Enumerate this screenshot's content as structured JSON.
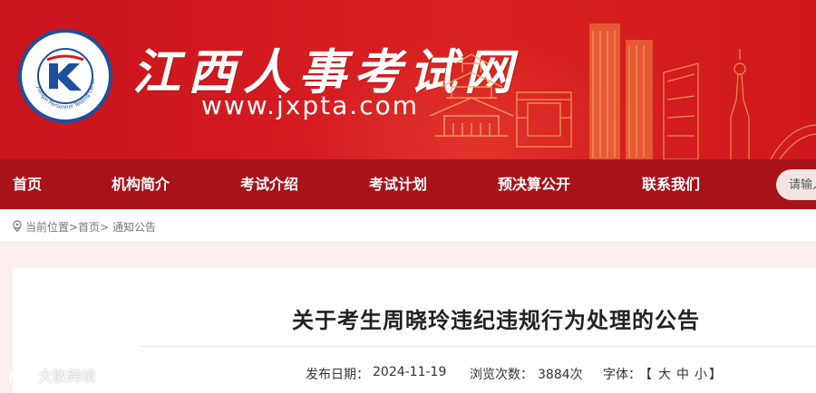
{
  "header": {
    "site_title": "江西人事考试网",
    "site_url": "www.jxpta.com",
    "logo_text": "Jiangxi Personnel Testing Center"
  },
  "nav": {
    "items": [
      {
        "label": "首页"
      },
      {
        "label": "机构简介"
      },
      {
        "label": "考试介绍"
      },
      {
        "label": "考试计划"
      },
      {
        "label": "预决算公开"
      },
      {
        "label": "联系我们"
      }
    ],
    "search_placeholder": "请输入"
  },
  "breadcrumb": {
    "prefix": "当前位置>",
    "home": "首页",
    "sep": ">",
    "current": "通知公告"
  },
  "article": {
    "title": "关于考生周晓玲违纪违规行为处理的公告",
    "publish_label": "发布日期：",
    "publish_date": "2024-11-19",
    "views_label": "浏览次数：",
    "views_count": "3884次",
    "font_label": "字体：",
    "font_open": "【",
    "font_large": "大",
    "font_medium": "中",
    "font_small": "小",
    "font_close": "】"
  },
  "watermark": "大散跨境",
  "colors": {
    "banner_red": "#d51c21",
    "nav_red": "#a8131a",
    "logo_blue": "#1c4f9e",
    "content_bg": "#fbefed"
  }
}
